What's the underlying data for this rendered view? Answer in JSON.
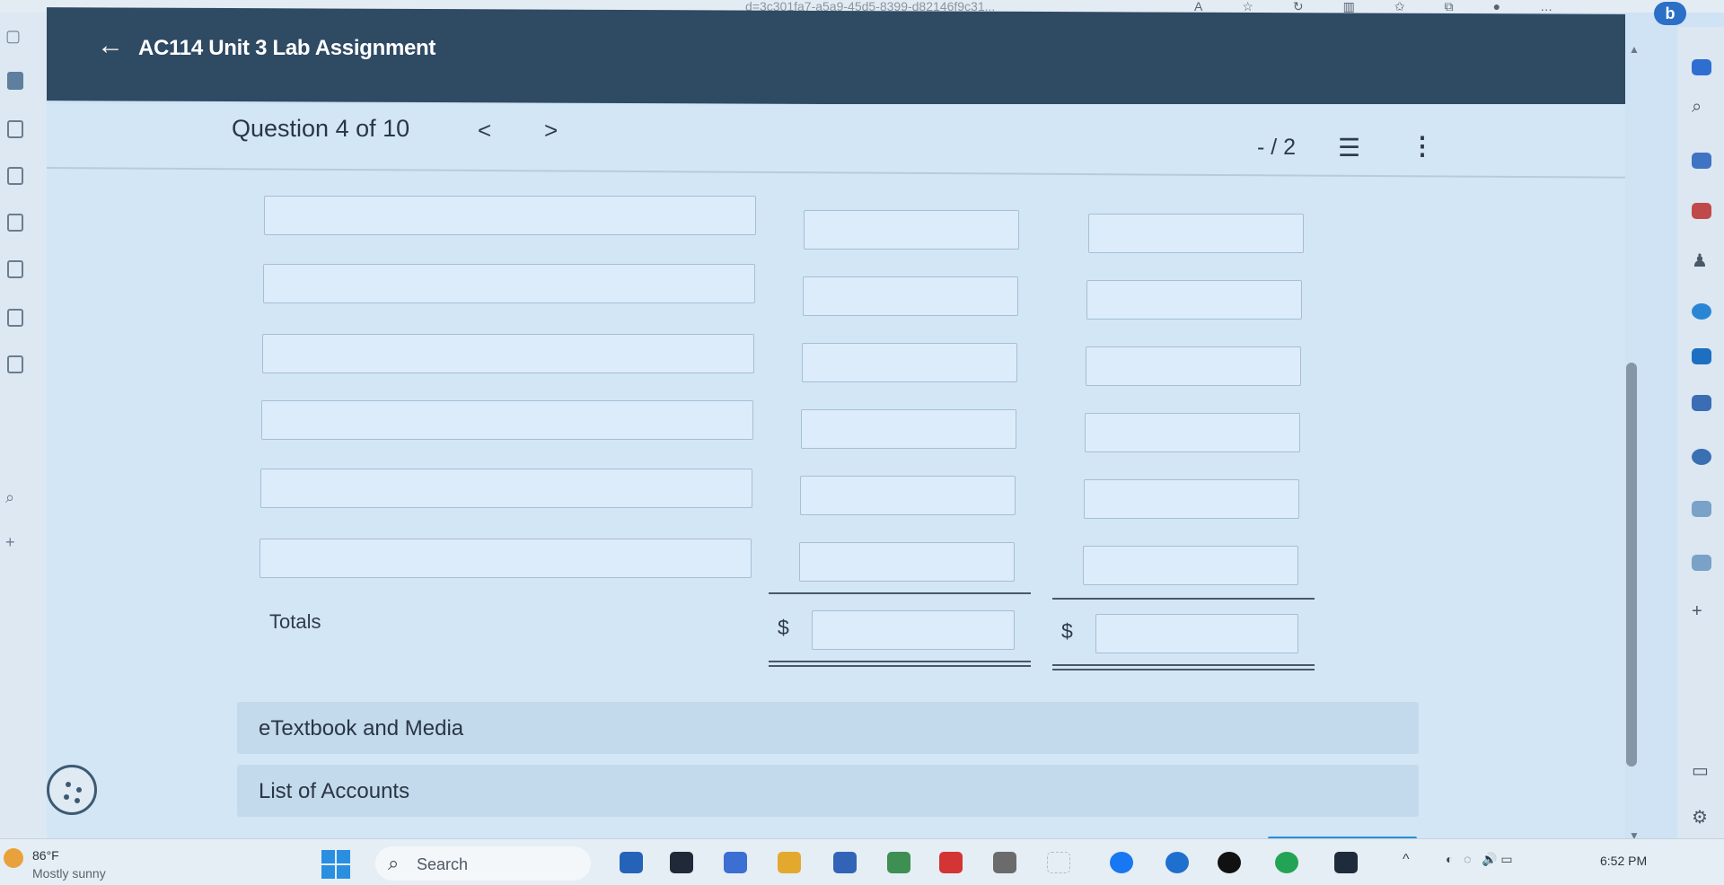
{
  "browser": {
    "url_fragment": "d=3c301fa7-a5a9-45d5-8399-d82146f9c31...",
    "profile_letter": "b"
  },
  "assignment": {
    "title": "AC114 Unit 3 Lab Assignment",
    "question_label": "Question 4 of 10",
    "prev_glyph": "<",
    "next_glyph": ">",
    "score": "- / 2"
  },
  "form": {
    "totals_label": "Totals",
    "currency_symbol": "$",
    "rows": 6
  },
  "accordions": [
    {
      "label": "eTextbook and Media"
    },
    {
      "label": "List of Accounts"
    }
  ],
  "taskbar": {
    "temperature": "86°F",
    "weather": "Mostly sunny",
    "search_label": "Search",
    "time": "6:52 PM"
  },
  "colors": {
    "header_bg": "#2f4a63",
    "content_bg": "#d2e6f6",
    "field_border": "#a6bfd4",
    "accent_blue": "#2c8fd6"
  }
}
